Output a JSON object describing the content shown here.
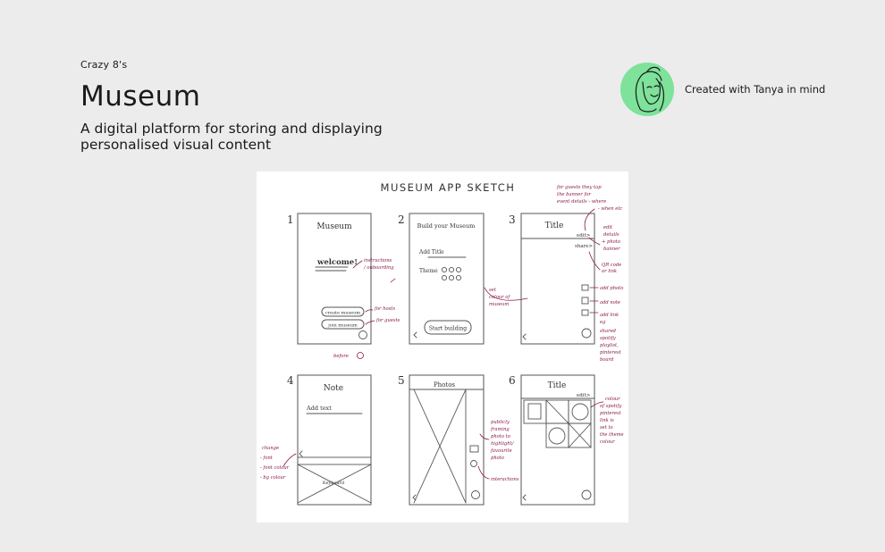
{
  "header": {
    "eyebrow": "Crazy 8's",
    "title": "Museum",
    "subtitle": "A digital platform for storing and displaying personalised visual content"
  },
  "credit": {
    "text": "Created with Tanya in mind",
    "avatar_bg": "#7ee29b"
  },
  "sketch": {
    "heading": "MUSEUM APP SKETCH",
    "ink": "#333333",
    "note_color": "#8b1a4a",
    "screens": [
      {
        "number": "1",
        "title": "Museum",
        "welcome": "welcome!",
        "create_btn": "create museum",
        "join_btn": "join museum"
      },
      {
        "number": "2",
        "title": "Build your Museum",
        "field": "Add Title",
        "theme": "Theme",
        "start_btn": "Start building"
      },
      {
        "number": "3",
        "title": "Title",
        "edit": "edit>",
        "share": "share>"
      },
      {
        "number": "4",
        "title": "Note",
        "field": "Add text",
        "keyboard": "Keyboard"
      },
      {
        "number": "5",
        "title": "Photos"
      },
      {
        "number": "6",
        "title": "Title",
        "edit": "edit>"
      }
    ],
    "notes": {
      "guests": [
        "for guests they tap",
        "the banner for",
        "event details - where",
        "- when etc"
      ],
      "instructions": [
        "instructions",
        "/ onboarding"
      ],
      "for_hosts": "for hosts",
      "for_guests": "for guests",
      "before": "before",
      "set_colour": [
        "set",
        "colour of",
        "museum"
      ],
      "edit_details": [
        "edit",
        "details",
        "+ photo",
        "banner"
      ],
      "qr": [
        "QR code",
        "or link"
      ],
      "add_photo": "add photo",
      "add_note": "add note",
      "add_link": [
        "add link",
        "eg",
        "shared",
        "spotify",
        "playlist,",
        "pinterest",
        "board"
      ],
      "change": [
        "change",
        "- font",
        "- font colour",
        "- bg colour"
      ],
      "publicly": [
        "publicly",
        "framing",
        "photo to",
        "highlight/",
        "favourite",
        "photo"
      ],
      "interactions": "interactions",
      "colour_spotify": [
        "colour",
        "of spotify",
        "pinterest",
        "link is",
        "set to",
        "the theme",
        "colour"
      ]
    }
  }
}
